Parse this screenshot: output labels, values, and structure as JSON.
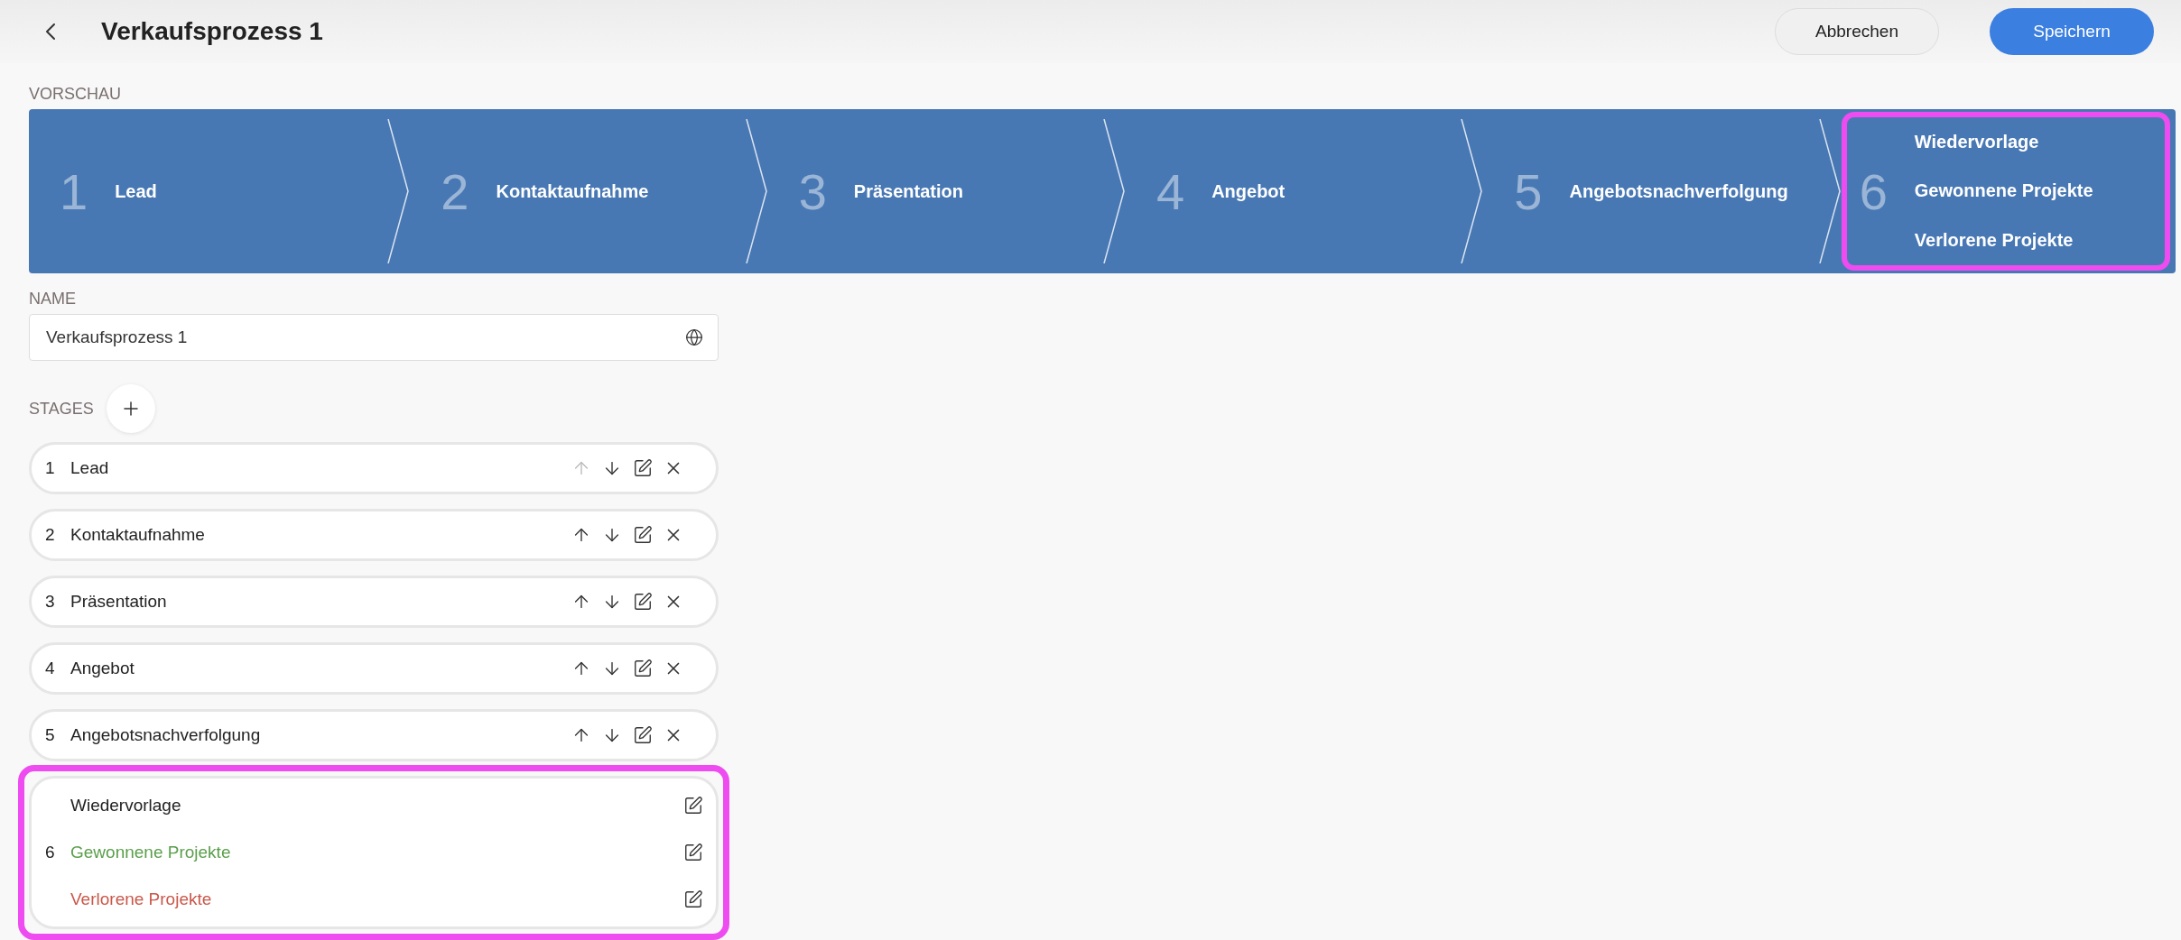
{
  "header": {
    "title": "Verkaufsprozess 1",
    "cancel": "Abbrechen",
    "save": "Speichern"
  },
  "preview": {
    "label": "VORSCHAU",
    "segments": [
      {
        "number": "1",
        "labels": [
          "Lead"
        ],
        "highlighted": false
      },
      {
        "number": "2",
        "labels": [
          "Kontaktaufnahme"
        ],
        "highlighted": false
      },
      {
        "number": "3",
        "labels": [
          "Präsentation"
        ],
        "highlighted": false
      },
      {
        "number": "4",
        "labels": [
          "Angebot"
        ],
        "highlighted": false
      },
      {
        "number": "5",
        "labels": [
          "Angebotsnachverfolgung"
        ],
        "highlighted": false
      },
      {
        "number": "6",
        "labels": [
          "Wiedervorlage",
          "Gewonnene Projekte",
          "Verlorene Projekte"
        ],
        "highlighted": true
      }
    ]
  },
  "name": {
    "label": "NAME",
    "value": "Verkaufsprozess 1"
  },
  "stages": {
    "label": "STAGES",
    "items": [
      {
        "kind": "stage",
        "number": "1",
        "name": "Lead",
        "up_disabled": true
      },
      {
        "kind": "stage",
        "number": "2",
        "name": "Kontaktaufnahme",
        "up_disabled": false
      },
      {
        "kind": "stage",
        "number": "3",
        "name": "Präsentation",
        "up_disabled": false
      },
      {
        "kind": "stage",
        "number": "4",
        "name": "Angebot",
        "up_disabled": false
      },
      {
        "kind": "stage",
        "number": "5",
        "name": "Angebotsnachverfolgung",
        "up_disabled": false
      },
      {
        "kind": "group",
        "number": "6",
        "highlighted": true,
        "entries": [
          {
            "name": "Wiedervorlage",
            "color": "#222222"
          },
          {
            "name": "Gewonnene Projekte",
            "color": "#5a9e4b"
          },
          {
            "name": "Verlorene Projekte",
            "color": "#c9574a"
          }
        ]
      }
    ]
  }
}
